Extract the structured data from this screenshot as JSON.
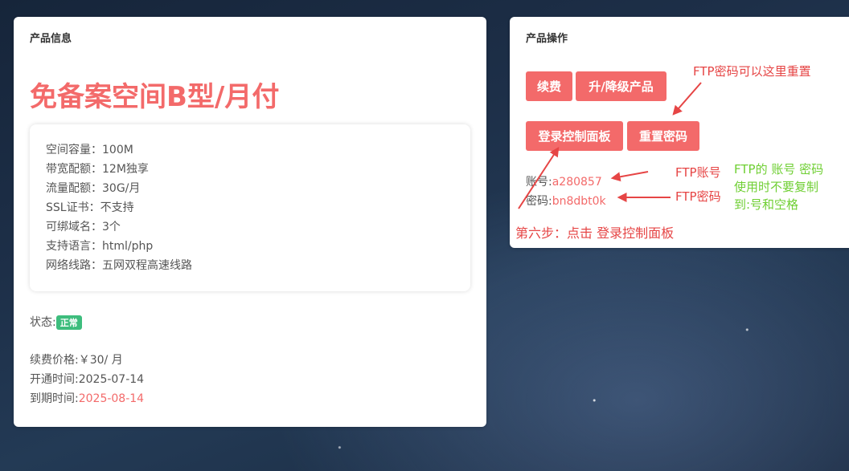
{
  "info": {
    "title": "产品信息",
    "product_name": "免备案空间B型/月付",
    "specs": [
      "空间容量：100M",
      "带宽配额：12M独享",
      "流量配额：30G/月",
      "SSL证书：不支持",
      "可绑域名：3个",
      "支持语言：html/php",
      "网络线路：五网双程高速线路"
    ],
    "status_label": "状态:",
    "status_badge": "正常",
    "price": "续费价格:￥30/ 月",
    "open_label": "开通时间:",
    "open_date": "2025-07-14",
    "expire_label": "到期时间:",
    "expire_date": "2025-08-14"
  },
  "ops": {
    "title": "产品操作",
    "buttons": {
      "renew": "续费",
      "upgrade": "升/降级产品",
      "login_panel": "登录控制面板",
      "reset_password": "重置密码"
    },
    "account_label": "账号:",
    "account_value": "a280857",
    "password_label": "密码:",
    "password_value": "bn8dbt0k"
  },
  "annotations": {
    "reset_note": "FTP密码可以这里重置",
    "ftp_account": "FTP账号",
    "ftp_password": "FTP密码",
    "step_six": "第六步：点击 登录控制面板",
    "copy_note_1": "FTP的 账号 密码",
    "copy_note_2": "使用时不要复制",
    "copy_note_3": "到:号和空格"
  },
  "colors": {
    "accent": "#f36a6a",
    "annotation_red": "#e64545",
    "annotation_green": "#6fcf33",
    "badge_green": "#3dbd7d"
  }
}
